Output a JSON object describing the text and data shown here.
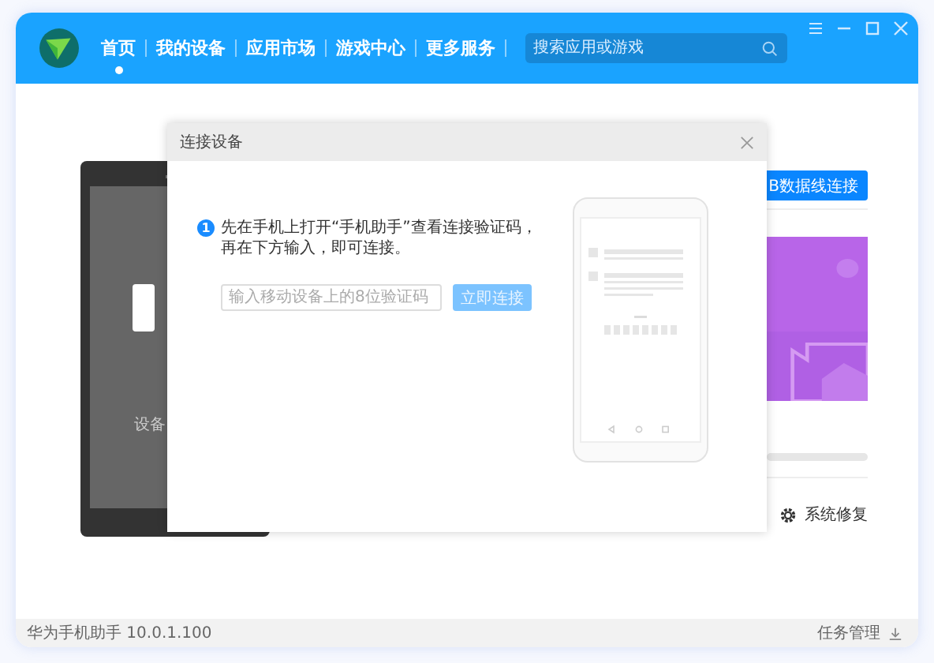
{
  "window": {
    "nav": [
      {
        "label": "首页",
        "selected": true
      },
      {
        "label": "我的设备",
        "selected": false
      },
      {
        "label": "应用市场",
        "selected": false
      },
      {
        "label": "游戏中心",
        "selected": false
      },
      {
        "label": "更多服务",
        "selected": false
      }
    ],
    "search": {
      "placeholder": "搜索应用或游戏"
    }
  },
  "background": {
    "device_caption": "设备",
    "usb_button": "B数据线连接",
    "repair": "系统修复"
  },
  "dialog": {
    "title": "连接设备",
    "step": "1",
    "instruction": "先在手机上打开“手机助手”查看连接验证码，再在下方输入，即可连接。",
    "code_field": {
      "placeholder": "输入移动设备上的8位验证码"
    },
    "connect_button": {
      "label": "立即连接",
      "disabled": true
    }
  },
  "status_bar": {
    "version": "华为手机助手 10.0.1.100",
    "tasks": "任务管理"
  }
}
